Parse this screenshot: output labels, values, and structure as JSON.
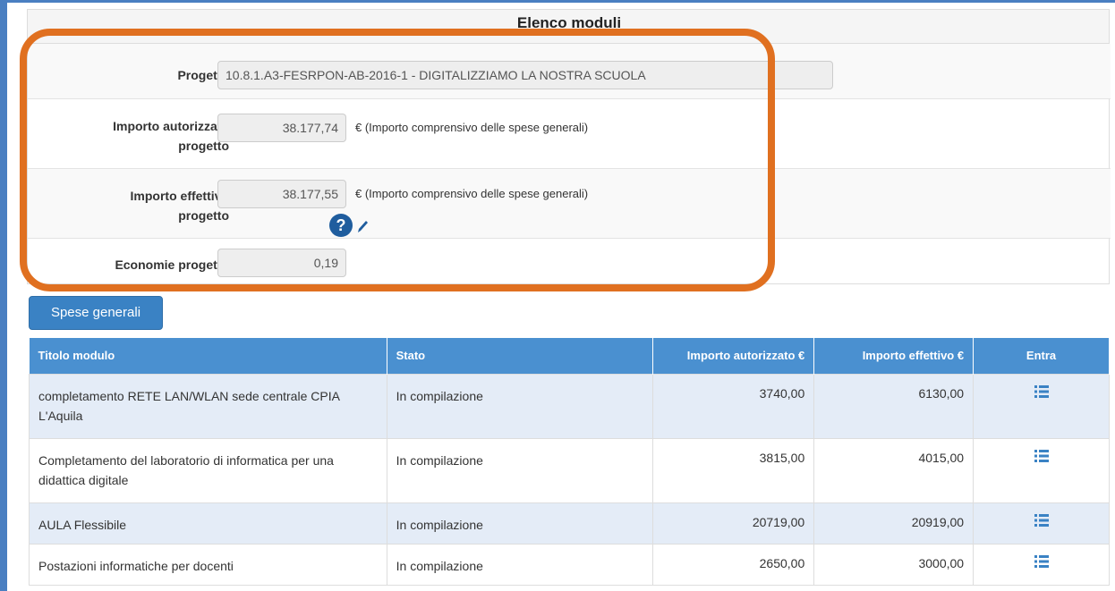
{
  "panel": {
    "title": "Elenco moduli"
  },
  "form": {
    "progetto": {
      "label": "Progetto",
      "value": "10.8.1.A3-FESRPON-AB-2016-1 - DIGITALIZZIAMO LA NOSTRA SCUOLA"
    },
    "importo_autorizzato": {
      "label_line1": "Importo autorizzato",
      "label_line2": "progetto",
      "value": "38.177,74",
      "note": "€ (Importo comprensivo delle spese generali)"
    },
    "importo_effettivo": {
      "label_line1": "Importo effettivo",
      "label_line2": "progetto",
      "value": "38.177,55",
      "note": "€ (Importo comprensivo delle spese generali)"
    },
    "economie": {
      "label": "Economie progetto",
      "value": "0,19",
      "help_icon": "question-circle-icon",
      "edit_icon": "pencil-icon"
    }
  },
  "spese_button": {
    "label": "Spese generali"
  },
  "table": {
    "headers": [
      "Titolo modulo",
      "Stato",
      "Importo autorizzato €",
      "Importo effettivo €",
      "Entra"
    ],
    "rows": [
      {
        "titolo": "completamento RETE LAN/WLAN sede centrale CPIA L'Aquila",
        "stato": "In compilazione",
        "autorizzato": "3740,00",
        "effettivo": "6130,00",
        "entra_icon": "list-icon"
      },
      {
        "titolo": "Completamento del laboratorio di informatica per una didattica digitale",
        "stato": "In compilazione",
        "autorizzato": "3815,00",
        "effettivo": "4015,00",
        "entra_icon": "list-icon"
      },
      {
        "titolo": "AULA Flessibile",
        "stato": "In compilazione",
        "autorizzato": "20719,00",
        "effettivo": "20919,00",
        "entra_icon": "list-icon"
      },
      {
        "titolo": "Postazioni informatiche per docenti",
        "stato": "In compilazione",
        "autorizzato": "2650,00",
        "effettivo": "3000,00",
        "entra_icon": "list-icon"
      }
    ]
  },
  "colors": {
    "accent_blue": "#4a90d0",
    "highlight_orange": "#e07020",
    "row_alt": "#e4ecf7"
  }
}
